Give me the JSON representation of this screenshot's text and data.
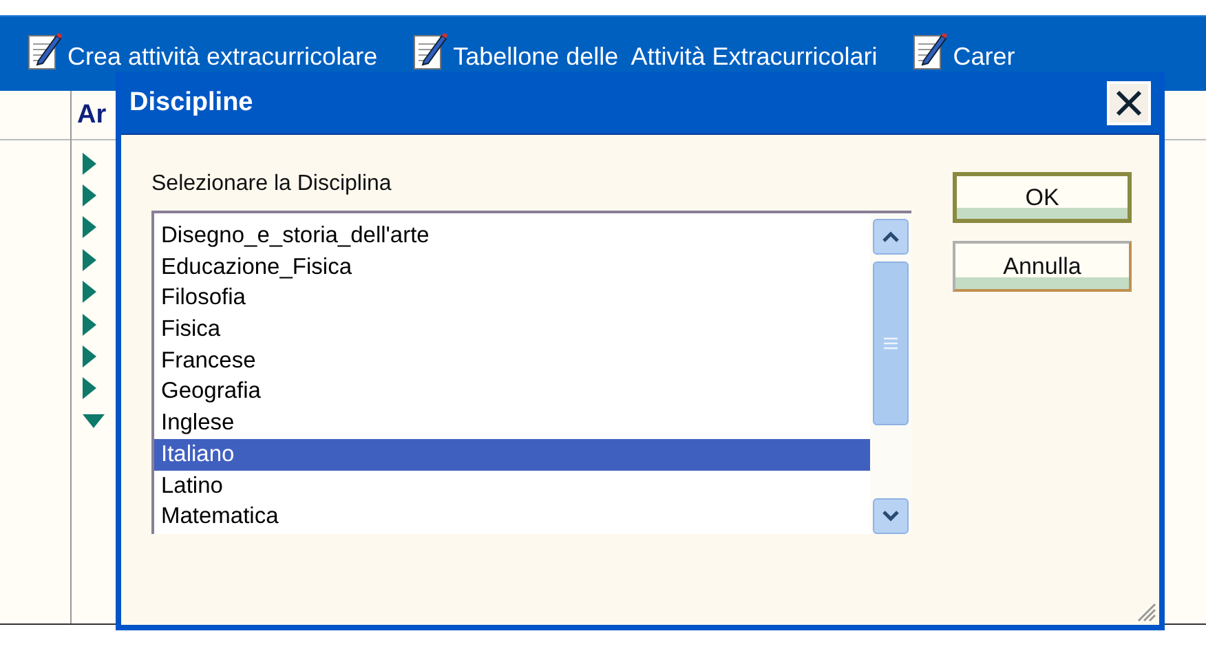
{
  "toolbar": {
    "items": [
      {
        "label": "Crea attività extracurricolare"
      },
      {
        "label": "Tabellone delle  Attività Extracurricolari"
      },
      {
        "label": "Carer"
      }
    ]
  },
  "table": {
    "header": "Ar",
    "rows": [
      {
        "expanded": false
      },
      {
        "expanded": false
      },
      {
        "expanded": false
      },
      {
        "expanded": false
      },
      {
        "expanded": false
      },
      {
        "expanded": false
      },
      {
        "expanded": false
      },
      {
        "expanded": false
      },
      {
        "expanded": true
      }
    ]
  },
  "dialog": {
    "title": "Discipline",
    "label": "Selezionare la Disciplina",
    "items": [
      {
        "label": "Disegno_e_storia_dell'arte",
        "selected": false
      },
      {
        "label": "Educazione_Fisica",
        "selected": false
      },
      {
        "label": "Filosofia",
        "selected": false
      },
      {
        "label": "Fisica",
        "selected": false
      },
      {
        "label": "Francese",
        "selected": false
      },
      {
        "label": "Geografia",
        "selected": false
      },
      {
        "label": "Inglese",
        "selected": false
      },
      {
        "label": "Italiano",
        "selected": true
      },
      {
        "label": "Latino",
        "selected": false
      },
      {
        "label": "Matematica",
        "selected": false
      }
    ],
    "buttons": [
      {
        "label": "OK",
        "kind": "default"
      },
      {
        "label": "Annulla",
        "kind": "normal"
      }
    ]
  }
}
